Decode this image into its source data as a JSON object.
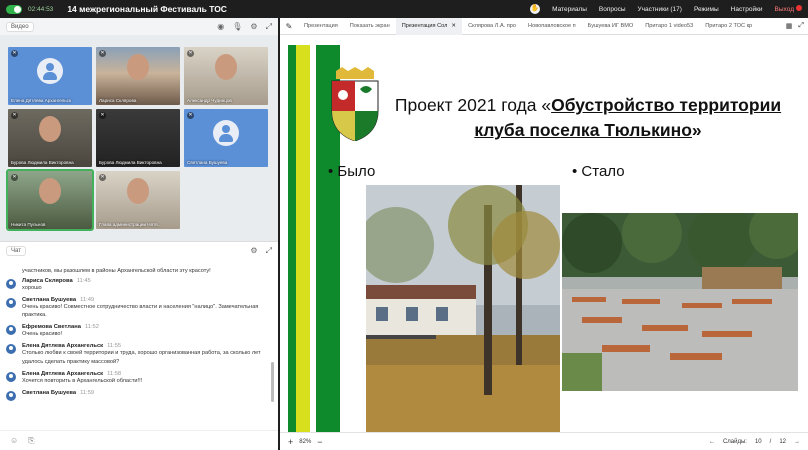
{
  "topbar": {
    "rec_time": "02:44:53",
    "title": "14 межрегиональный Фестиваль ТОС",
    "nav": [
      "Материалы",
      "Вопросы",
      "Участники (17)",
      "Режимы",
      "Настройки"
    ],
    "exit": "Выход"
  },
  "video_panel": {
    "label": "Видео",
    "participants": [
      {
        "name": "Елена Дятлева Архангельск"
      },
      {
        "name": "Лариса Склярова"
      },
      {
        "name": "Александр Чудинцов"
      },
      {
        "name": "Бурова Людмила Викторовна"
      },
      {
        "name": "Бурова Людмила Викторовна"
      },
      {
        "name": "Светлана Бушуева"
      },
      {
        "name": "Никита Пульнов"
      },
      {
        "name": "Глава администрации Нятв..."
      }
    ]
  },
  "chat": {
    "label": "Чат",
    "continuation": "участников, мы разошлем в районы Архангельской области эту красоту!",
    "messages": [
      {
        "author": "Лариса Склярова",
        "time": "11:45",
        "text": "хорошо"
      },
      {
        "author": "Светлана Бушуева",
        "time": "11:49",
        "text": "Очень красиво! Совместное сотрудничество власти и населения \"налицо\". Замечательная практика."
      },
      {
        "author": "Ефремова Светлана",
        "time": "11:52",
        "text": "Очень красиво!"
      },
      {
        "author": "Елена Дятлева Архангельск",
        "time": "11:55",
        "text": "Столько любви к своей территории и труда, хорошо организованная работа, за сколько лет удалось сделать практику массовой?"
      },
      {
        "author": "Елена Дятлева Архангельск",
        "time": "11:58",
        "text": "Хочется повторить в Архангельской области!!!"
      },
      {
        "author": "Светлана Бушуева",
        "time": "11:59",
        "text": ""
      }
    ]
  },
  "tabs": [
    {
      "label": "Презентация",
      "active": false
    },
    {
      "label": "Показать экран",
      "active": false
    },
    {
      "label": "Презентация Сол",
      "active": true
    },
    {
      "label": "Склярова Л.А. про",
      "active": false
    },
    {
      "label": "Новопавловское п",
      "active": false
    },
    {
      "label": "Бушуева ИГ ВМО",
      "active": false
    },
    {
      "label": "Притаро 1 video53",
      "active": false
    },
    {
      "label": "Притаро 2 ТОС кр",
      "active": false
    }
  ],
  "slide": {
    "title_prefix": "Проект 2021 года «",
    "title_link": "Обустройство территории клуба поселка Тюлькино",
    "title_suffix": "»",
    "before_label": "• Было",
    "after_label": "• Стало",
    "colors": {
      "green": "#0e8a2c",
      "yellow": "#d8e01e"
    }
  },
  "bottom": {
    "zoom": "82%",
    "slides_label": "Слайды:",
    "current": "10",
    "separator": "/",
    "total": "12"
  }
}
